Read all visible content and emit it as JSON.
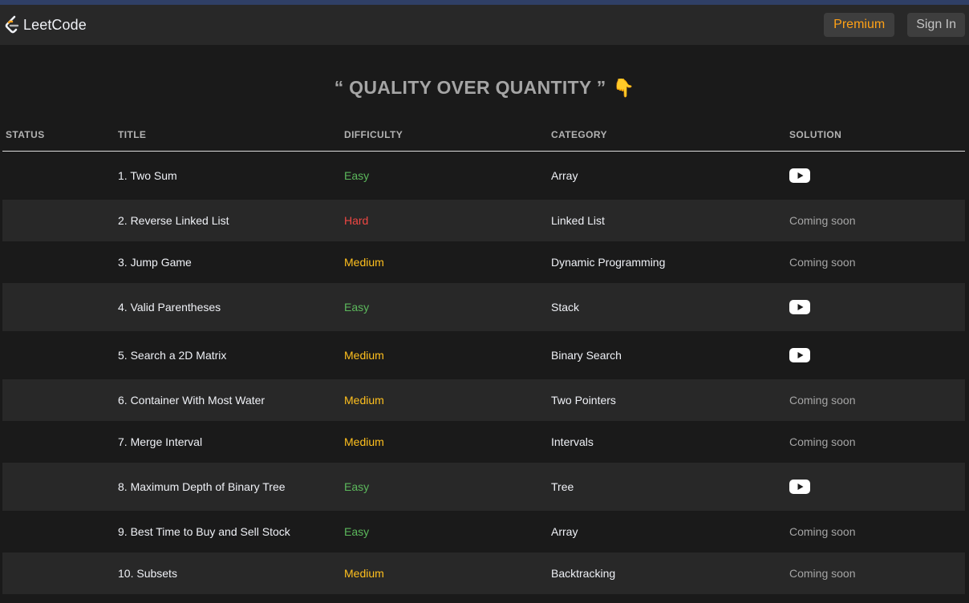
{
  "navbar": {
    "brand": "LeetCode",
    "premium_label": "Premium",
    "signin_label": "Sign In"
  },
  "headline": {
    "text": "“ QUALITY OVER QUANTITY ”",
    "emoji": "👇"
  },
  "table": {
    "headers": {
      "status": "STATUS",
      "title": "TITLE",
      "difficulty": "DIFFICULTY",
      "category": "CATEGORY",
      "solution": "SOLUTION"
    },
    "rows": [
      {
        "title": "1. Two Sum",
        "difficulty": "Easy",
        "category": "Array",
        "solution": "video",
        "solution_icon": "youtube-play-icon"
      },
      {
        "title": "2. Reverse Linked List",
        "difficulty": "Hard",
        "category": "Linked List",
        "solution": "Coming soon"
      },
      {
        "title": "3. Jump Game",
        "difficulty": "Medium",
        "category": "Dynamic Programming",
        "solution": "Coming soon"
      },
      {
        "title": "4. Valid Parentheses",
        "difficulty": "Easy",
        "category": "Stack",
        "solution": "video",
        "solution_icon": "youtube-play-icon"
      },
      {
        "title": "5. Search a 2D Matrix",
        "difficulty": "Medium",
        "category": "Binary Search",
        "solution": "video",
        "solution_icon": "youtube-play-icon"
      },
      {
        "title": "6. Container With Most Water",
        "difficulty": "Medium",
        "category": "Two Pointers",
        "solution": "Coming soon"
      },
      {
        "title": "7. Merge Interval",
        "difficulty": "Medium",
        "category": "Intervals",
        "solution": "Coming soon"
      },
      {
        "title": "8. Maximum Depth of Binary Tree",
        "difficulty": "Easy",
        "category": "Tree",
        "solution": "video",
        "solution_icon": "youtube-play-icon"
      },
      {
        "title": "9. Best Time to Buy and Sell Stock",
        "difficulty": "Easy",
        "category": "Array",
        "solution": "Coming soon"
      },
      {
        "title": "10. Subsets",
        "difficulty": "Medium",
        "category": "Backtracking",
        "solution": "Coming soon"
      }
    ]
  },
  "colors": {
    "background": "#1a1a1a",
    "navbar": "#282828",
    "accent_premium": "#ffa116",
    "easy": "#5cb85c",
    "medium": "#ffc01e",
    "hard": "#ef4743"
  }
}
